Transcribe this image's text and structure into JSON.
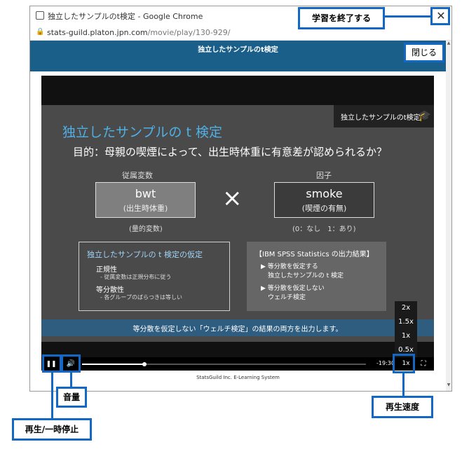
{
  "browser": {
    "title": "独立したサンプルのt検定 - Google Chrome",
    "url_host": "stats-guild.platon.jpn.com",
    "url_path": "/movie/play/130-929/",
    "minimize": "–",
    "close": "✕"
  },
  "page": {
    "header_title": "独立したサンプルのt検定"
  },
  "slide": {
    "badge": "独立したサンプルのt検定",
    "title": "独立したサンプルの t 検定",
    "purpose": "目的：母親の喫煙によって、出生時体重に有意差が認められるか？",
    "dependent_label": "従属変数",
    "factor_label": "因子",
    "dependent_main": "bwt",
    "dependent_sub": "(出生時体重)",
    "factor_main": "smoke",
    "factor_sub": "(喫煙の有無)",
    "times": "×",
    "dependent_type": "(量的変数)",
    "factor_values": "(0：なし　1：あり)",
    "assumptions": {
      "title": "独立したサンプルの t 検定の仮定",
      "normality": "正規性",
      "normality_sub": "- 従属変数は正規分布に従う",
      "equal_variance": "等分散性",
      "equal_variance_sub": "- 各グループのばらつきは等しい"
    },
    "spss": {
      "title": "【IBM SPSS Statistics の出力結果】",
      "item1_a": "▶ 等分散を仮定する",
      "item1_b": "独立したサンプルの t 検定",
      "item2_a": "▶ 等分散を仮定しない",
      "item2_b": "ウェルチ検定"
    },
    "caption": "等分散を仮定しない「ウェルチ検定」の結果の両方を出力します。"
  },
  "player": {
    "time_remaining": "-19:30",
    "progress": 0.22,
    "speed": "1x",
    "speed_options": [
      "2x",
      "1.5x",
      "1x",
      "0.5x"
    ]
  },
  "footer": "StatsGuild Inc. E-Learning System",
  "annotations": {
    "end_learning": "学習を終了する",
    "close": "閉じる",
    "volume": "音量",
    "play_pause": "再生/一時停止",
    "speed": "再生速度"
  },
  "colors": {
    "accent": "#1268c4",
    "header": "#1a5e8a",
    "slide_title": "#4fb0e6"
  }
}
